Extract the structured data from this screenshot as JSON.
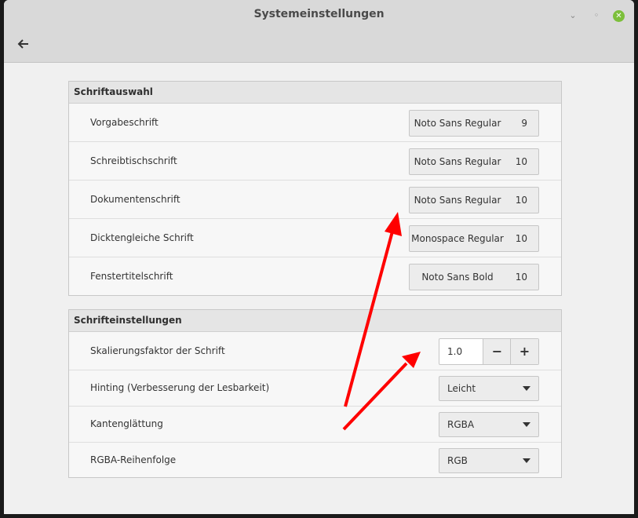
{
  "window": {
    "title": "Systemeinstellungen",
    "back_icon": "back-arrow-icon"
  },
  "schriftauswahl": {
    "header": "Schriftauswahl",
    "rows": [
      {
        "label": "Vorgabeschrift",
        "font": "Noto Sans Regular",
        "size": "9"
      },
      {
        "label": "Schreibtischschrift",
        "font": "Noto Sans Regular",
        "size": "10"
      },
      {
        "label": "Dokumentenschrift",
        "font": "Noto Sans Regular",
        "size": "10"
      },
      {
        "label": "Dicktengleiche Schrift",
        "font": "Monospace Regular",
        "size": "10"
      },
      {
        "label": "Fenstertitelschrift",
        "font": "Noto Sans Bold",
        "size": "10"
      }
    ]
  },
  "schrifteinstellungen": {
    "header": "Schrifteinstellungen",
    "scaling": {
      "label": "Skalierungsfaktor der Schrift",
      "value": "1.0",
      "minus": "−",
      "plus": "+"
    },
    "hinting": {
      "label": "Hinting (Verbesserung der Lesbarkeit)",
      "value": "Leicht"
    },
    "antialiasing": {
      "label": "Kantenglättung",
      "value": "RGBA"
    },
    "rgba_order": {
      "label": "RGBA-Reihenfolge",
      "value": "RGB"
    }
  },
  "colors": {
    "annotation_arrow": "#ff0000",
    "close_button": "#7cbf3a"
  }
}
